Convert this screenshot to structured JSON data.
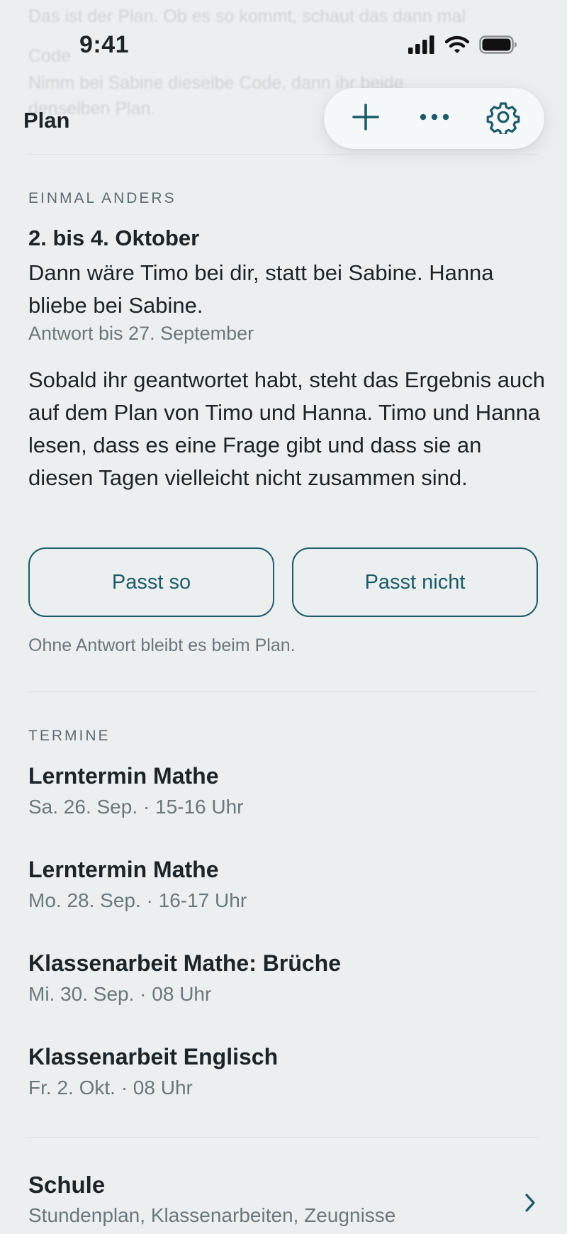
{
  "ghost_lines": [
    "Das ist der Plan. Ob es so kommt, schaut das dann mal",
    "Code",
    "Nimm bei Sabine dieselbe Code, dann ihr beide",
    "denselben Plan."
  ],
  "status_bar": {
    "time": "9:41",
    "icons": [
      "signal-icon",
      "wifi-icon",
      "battery-icon"
    ]
  },
  "header": {
    "title": "Plan",
    "actions": [
      "add-icon",
      "more-icon",
      "settings-icon"
    ]
  },
  "proposal": {
    "section_label": "EINMAL ANDERS",
    "title": "2. bis 4. Oktober",
    "description": "Dann wäre Timo bei dir, statt bei Sabine. Hanna bliebe bei Sabine.",
    "deadline": "Antwort bis 27. September",
    "info": "Sobald ihr geantwortet habt, steht das Ergebnis auch auf dem Plan von Timo und Hanna. Timo und Hanna lesen, dass es eine Frage gibt und dass sie an diesen Tagen vielleicht nicht zusammen sind.",
    "accept_label": "Passt so",
    "decline_label": "Passt nicht",
    "hint": "Ohne Antwort bleibt es beim Plan."
  },
  "appointments": {
    "section_label": "TERMINE",
    "items": [
      {
        "title": "Lerntermin Mathe",
        "meta": "Sa. 26. Sep. · 15-16 Uhr"
      },
      {
        "title": "Lerntermin Mathe",
        "meta": "Mo. 28. Sep. · 16-17 Uhr"
      },
      {
        "title": "Klassenarbeit Mathe: Brüche",
        "meta": "Mi. 30. Sep. · 08 Uhr"
      },
      {
        "title": "Klassenarbeit Englisch",
        "meta": "Fr. 2. Okt. · 08 Uhr"
      }
    ]
  },
  "school": {
    "title": "Schule",
    "subtitle": "Stundenplan, Klassenarbeiten, Zeugnisse"
  },
  "colors": {
    "background": "#eceff0",
    "accent": "#1d5b68",
    "text": "#1c2427",
    "muted": "#6c777b"
  }
}
